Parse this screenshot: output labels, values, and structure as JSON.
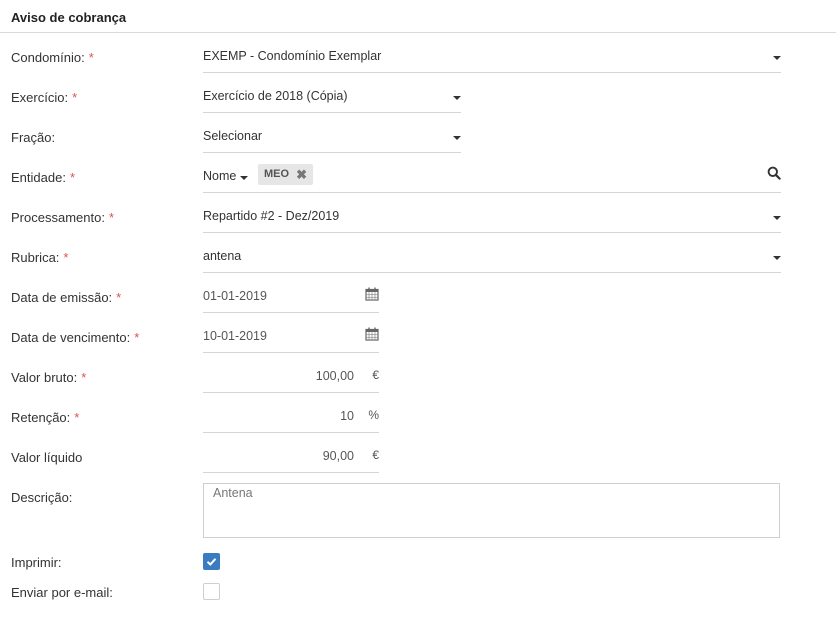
{
  "header": {
    "title": "Aviso de cobrança"
  },
  "form": {
    "required_mark": "*",
    "condominio": {
      "label": "Condomínio:",
      "value": "EXEMP - Condomínio Exemplar"
    },
    "exercicio": {
      "label": "Exercício:",
      "value": "Exercício de 2018 (Cópia)"
    },
    "fracao": {
      "label": "Fração:",
      "value": "Selecionar"
    },
    "entidade": {
      "label": "Entidade:",
      "filter_label": "Nome",
      "tag": "MEO"
    },
    "processamento": {
      "label": "Processamento:",
      "value": "Repartido #2 - Dez/2019"
    },
    "rubrica": {
      "label": "Rubrica:",
      "value": "antena"
    },
    "data_emissao": {
      "label": "Data de emissão:",
      "value": "01-01-2019"
    },
    "data_vencimento": {
      "label": "Data de vencimento:",
      "value": "10-01-2019"
    },
    "valor_bruto": {
      "label": "Valor bruto:",
      "value": "100,00",
      "unit": "€"
    },
    "retencao": {
      "label": "Retenção:",
      "value": "10",
      "unit": "%"
    },
    "valor_liquido": {
      "label": "Valor líquido",
      "value": "90,00",
      "unit": "€"
    },
    "descricao": {
      "label": "Descrição:",
      "value": "Antena"
    },
    "imprimir": {
      "label": "Imprimir:",
      "checked": true
    },
    "enviar_email": {
      "label": "Enviar por e-mail:",
      "checked": false
    }
  },
  "colors": {
    "accent": "#3a7cc1",
    "required": "#d9534f"
  }
}
